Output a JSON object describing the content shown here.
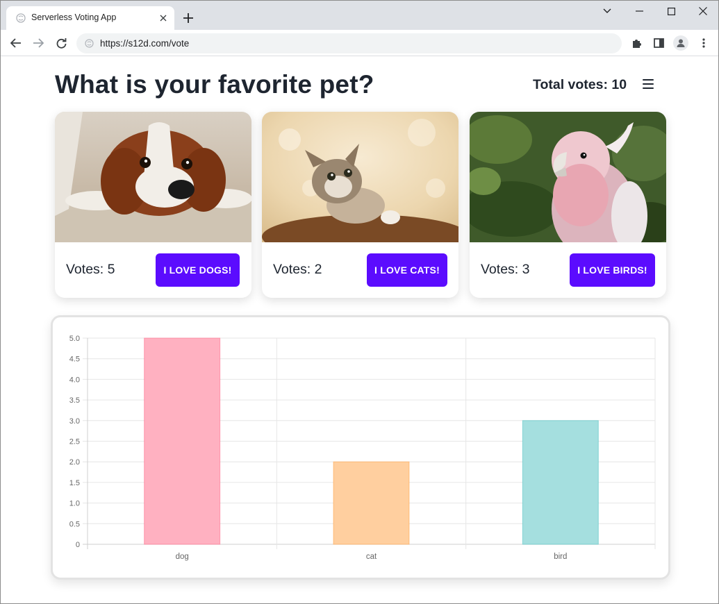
{
  "browser": {
    "tab_title": "Serverless Voting App",
    "url": "https://s12d.com/vote"
  },
  "page": {
    "title": "What is your favorite pet?",
    "total_votes_label": "Total votes: 10"
  },
  "cards": [
    {
      "animal": "dog",
      "votes_label": "Votes: 5",
      "button_label": "I LOVE DOGS!"
    },
    {
      "animal": "cat",
      "votes_label": "Votes: 2",
      "button_label": "I LOVE CATS!"
    },
    {
      "animal": "bird",
      "votes_label": "Votes: 3",
      "button_label": "I LOVE BIRDS!"
    }
  ],
  "colors": {
    "accent": "#5b0cfe",
    "heading": "#1e2530"
  },
  "chart_data": {
    "type": "bar",
    "categories": [
      "dog",
      "cat",
      "bird"
    ],
    "values": [
      5,
      2,
      3
    ],
    "ylim": [
      0,
      5
    ],
    "yticks": [
      "0",
      "0.5",
      "1.0",
      "1.5",
      "2.0",
      "2.5",
      "3.0",
      "3.5",
      "4.0",
      "4.5",
      "5.0"
    ],
    "bar_fill": [
      "#ffb1c1",
      "#ffcf9f",
      "#a5dfdf"
    ],
    "bar_stroke": [
      "#ff6384",
      "#ff9f40",
      "#4bc0c0"
    ],
    "grid": true,
    "legend": "none"
  }
}
